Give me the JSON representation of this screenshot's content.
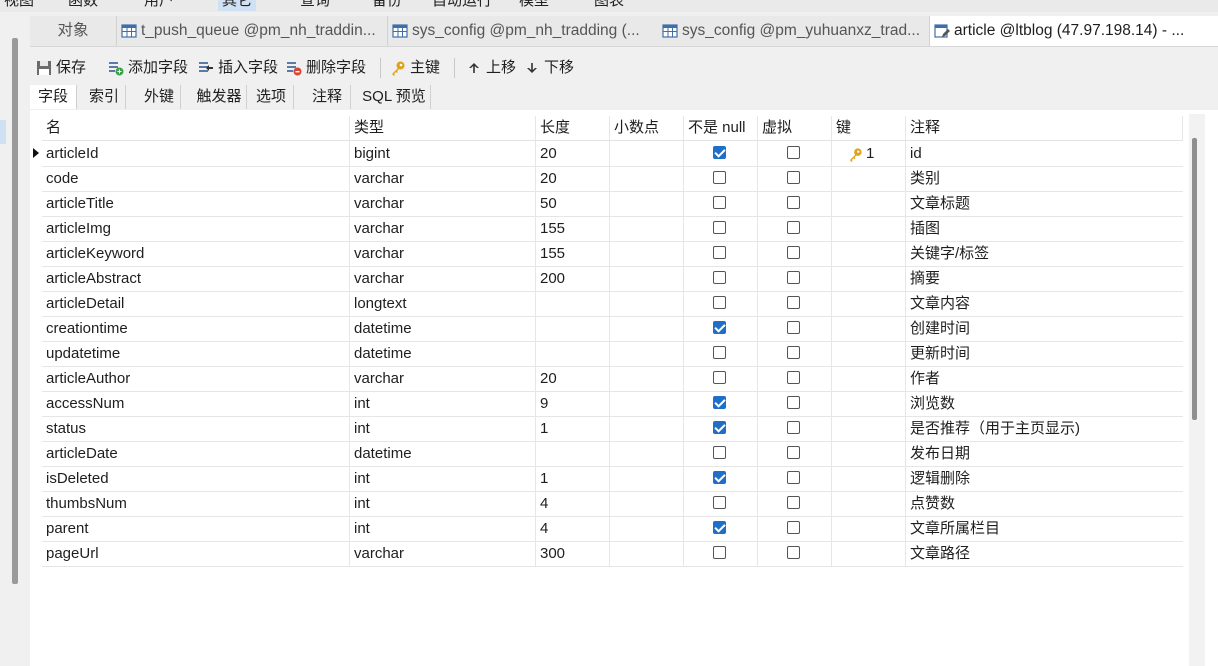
{
  "top_menu": [
    "视图",
    "函数",
    "用户",
    "其它",
    "查询",
    "备份",
    "自动运行",
    "模型",
    "图表"
  ],
  "tabs": [
    {
      "label": "对象",
      "icon": "none",
      "active": false
    },
    {
      "label": "t_push_queue @pm_nh_traddin...",
      "icon": "table-icon",
      "active": false
    },
    {
      "label": "sys_config @pm_nh_tradding (...",
      "icon": "table-icon",
      "active": false
    },
    {
      "label": "sys_config @pm_yuhuanxz_trad...",
      "icon": "table-icon",
      "active": false
    },
    {
      "label": "article @ltblog (47.97.198.14) - ...",
      "icon": "design-table-icon",
      "active": true
    }
  ],
  "toolbar": {
    "save": "保存",
    "add_field": "添加字段",
    "insert_field": "插入字段",
    "delete_field": "删除字段",
    "primary_key": "主键",
    "move_up": "上移",
    "move_down": "下移"
  },
  "subtabs": [
    "字段",
    "索引",
    "外键",
    "触发器",
    "选项",
    "注释",
    "SQL 预览"
  ],
  "columns": [
    "名",
    "类型",
    "长度",
    "小数点",
    "不是 null",
    "虚拟",
    "键",
    "注释"
  ],
  "rows": [
    {
      "name": "articleId",
      "type": "bigint",
      "length": "20",
      "decimals": "",
      "not_null": true,
      "virtual": false,
      "key": "1",
      "comment": "id"
    },
    {
      "name": "code",
      "type": "varchar",
      "length": "20",
      "decimals": "",
      "not_null": false,
      "virtual": false,
      "key": "",
      "comment": "类别"
    },
    {
      "name": "articleTitle",
      "type": "varchar",
      "length": "50",
      "decimals": "",
      "not_null": false,
      "virtual": false,
      "key": "",
      "comment": "文章标题"
    },
    {
      "name": "articleImg",
      "type": "varchar",
      "length": "155",
      "decimals": "",
      "not_null": false,
      "virtual": false,
      "key": "",
      "comment": "插图"
    },
    {
      "name": "articleKeyword",
      "type": "varchar",
      "length": "155",
      "decimals": "",
      "not_null": false,
      "virtual": false,
      "key": "",
      "comment": "关键字/标签"
    },
    {
      "name": "articleAbstract",
      "type": "varchar",
      "length": "200",
      "decimals": "",
      "not_null": false,
      "virtual": false,
      "key": "",
      "comment": "摘要"
    },
    {
      "name": "articleDetail",
      "type": "longtext",
      "length": "",
      "decimals": "",
      "not_null": false,
      "virtual": false,
      "key": "",
      "comment": "文章内容"
    },
    {
      "name": "creationtime",
      "type": "datetime",
      "length": "",
      "decimals": "",
      "not_null": true,
      "virtual": false,
      "key": "",
      "comment": "创建时间"
    },
    {
      "name": "updatetime",
      "type": "datetime",
      "length": "",
      "decimals": "",
      "not_null": false,
      "virtual": false,
      "key": "",
      "comment": "更新时间"
    },
    {
      "name": "articleAuthor",
      "type": "varchar",
      "length": "20",
      "decimals": "",
      "not_null": false,
      "virtual": false,
      "key": "",
      "comment": "作者"
    },
    {
      "name": "accessNum",
      "type": "int",
      "length": "9",
      "decimals": "",
      "not_null": true,
      "virtual": false,
      "key": "",
      "comment": "浏览数"
    },
    {
      "name": "status",
      "type": "int",
      "length": "1",
      "decimals": "",
      "not_null": true,
      "virtual": false,
      "key": "",
      "comment": "是否推荐（用于主页显示)"
    },
    {
      "name": "articleDate",
      "type": "datetime",
      "length": "",
      "decimals": "",
      "not_null": false,
      "virtual": false,
      "key": "",
      "comment": "发布日期"
    },
    {
      "name": "isDeleted",
      "type": "int",
      "length": "1",
      "decimals": "",
      "not_null": true,
      "virtual": false,
      "key": "",
      "comment": "逻辑删除"
    },
    {
      "name": "thumbsNum",
      "type": "int",
      "length": "4",
      "decimals": "",
      "not_null": false,
      "virtual": false,
      "key": "",
      "comment": "点赞数"
    },
    {
      "name": "parent",
      "type": "int",
      "length": "4",
      "decimals": "",
      "not_null": true,
      "virtual": false,
      "key": "",
      "comment": "文章所属栏目"
    },
    {
      "name": "pageUrl",
      "type": "varchar",
      "length": "300",
      "decimals": "",
      "not_null": false,
      "virtual": false,
      "key": "",
      "comment": "文章路径"
    }
  ],
  "colors": {
    "accent": "#1f6fc9",
    "key_icon": "#e0a21a",
    "selected_menu": "#cfe1f3"
  }
}
